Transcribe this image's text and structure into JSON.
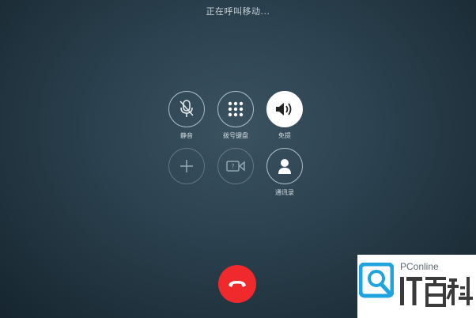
{
  "call": {
    "status": "正在呼叫移动..."
  },
  "controls": {
    "mute_label": "静音",
    "keypad_label": "拨号键盘",
    "speaker_label": "免提",
    "add_call_label": "",
    "facetime_label": "",
    "contacts_label": "通讯录"
  },
  "colors": {
    "end_call": "#f0292c",
    "background": "#2c4250",
    "watermark_accent": "#1fa4e0"
  },
  "watermark": {
    "site": "PConline",
    "brand": "IT百科"
  }
}
